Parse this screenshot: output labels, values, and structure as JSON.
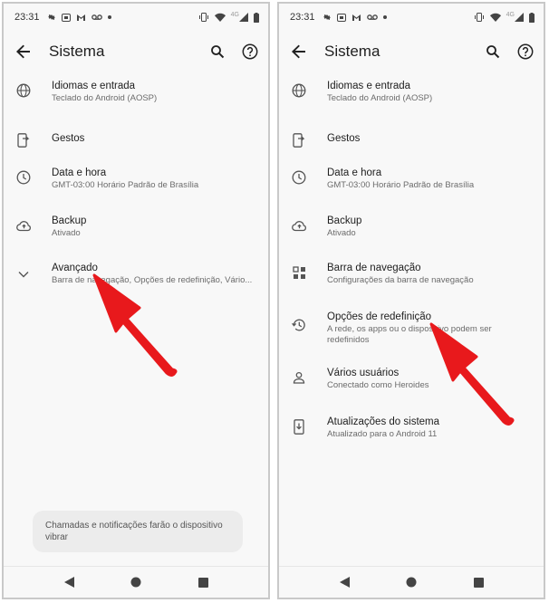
{
  "left": {
    "status": {
      "time": "23:31",
      "network": "4G"
    },
    "appbar": {
      "title": "Sistema"
    },
    "items": [
      {
        "icon": "globe-icon",
        "title": "Idiomas e entrada",
        "subtitle": "Teclado do Android (AOSP)"
      },
      {
        "icon": "gestures-icon",
        "title": "Gestos",
        "subtitle": ""
      },
      {
        "icon": "clock-icon",
        "title": "Data e hora",
        "subtitle": "GMT-03:00 Horário Padrão de Brasília"
      },
      {
        "icon": "cloud-upload-icon",
        "title": "Backup",
        "subtitle": "Ativado"
      },
      {
        "icon": "chevron-down-icon",
        "title": "Avançado",
        "subtitle": "Barra de navegação, Opções de redefinição, Vário..."
      }
    ],
    "toast": "Chamadas e notificações farão o dispositivo vibrar"
  },
  "right": {
    "status": {
      "time": "23:31",
      "network": "4G"
    },
    "appbar": {
      "title": "Sistema"
    },
    "items": [
      {
        "icon": "globe-icon",
        "title": "Idiomas e entrada",
        "subtitle": "Teclado do Android (AOSP)"
      },
      {
        "icon": "gestures-icon",
        "title": "Gestos",
        "subtitle": ""
      },
      {
        "icon": "clock-icon",
        "title": "Data e hora",
        "subtitle": "GMT-03:00 Horário Padrão de Brasília"
      },
      {
        "icon": "cloud-upload-icon",
        "title": "Backup",
        "subtitle": "Ativado"
      },
      {
        "icon": "navigation-bar-icon",
        "title": "Barra de navegação",
        "subtitle": "Configurações da barra de navegação"
      },
      {
        "icon": "history-icon",
        "title": "Opções de redefinição",
        "subtitle": "A rede, os apps ou o dispositivo podem ser redefinidos"
      },
      {
        "icon": "person-icon",
        "title": "Vários usuários",
        "subtitle": "Conectado como Heroides"
      },
      {
        "icon": "system-update-icon",
        "title": "Atualizações do sistema",
        "subtitle": "Atualizado para o Android 11"
      }
    ]
  },
  "colors": {
    "arrow": "#e8191c",
    "background": "#f8f8f8",
    "text": "#202020",
    "subtext": "#6b6b6b"
  }
}
